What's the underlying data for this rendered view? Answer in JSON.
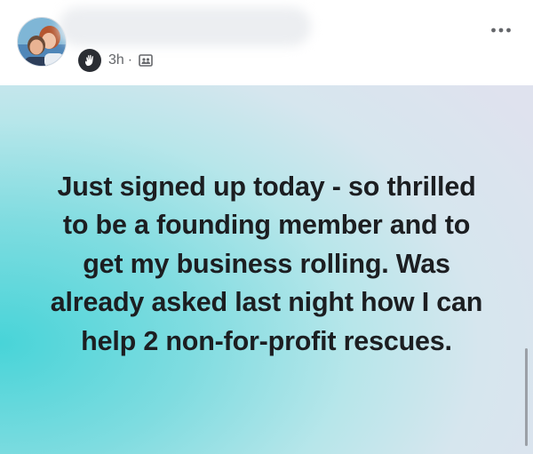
{
  "post": {
    "time": "3h",
    "separator": "·",
    "text": "Just signed up today - so thrilled to be a founding member and to get my business rolling. Was already asked last night how I can help 2 non-for-profit rescues."
  },
  "icons": {
    "badge": "waving-hand-icon",
    "audience": "group-audience-icon",
    "more": "more-options-icon"
  },
  "colors": {
    "text": "#1c1e21",
    "meta": "#65676b",
    "background_start": "#48d4d8",
    "background_end": "#dfe2ee"
  }
}
